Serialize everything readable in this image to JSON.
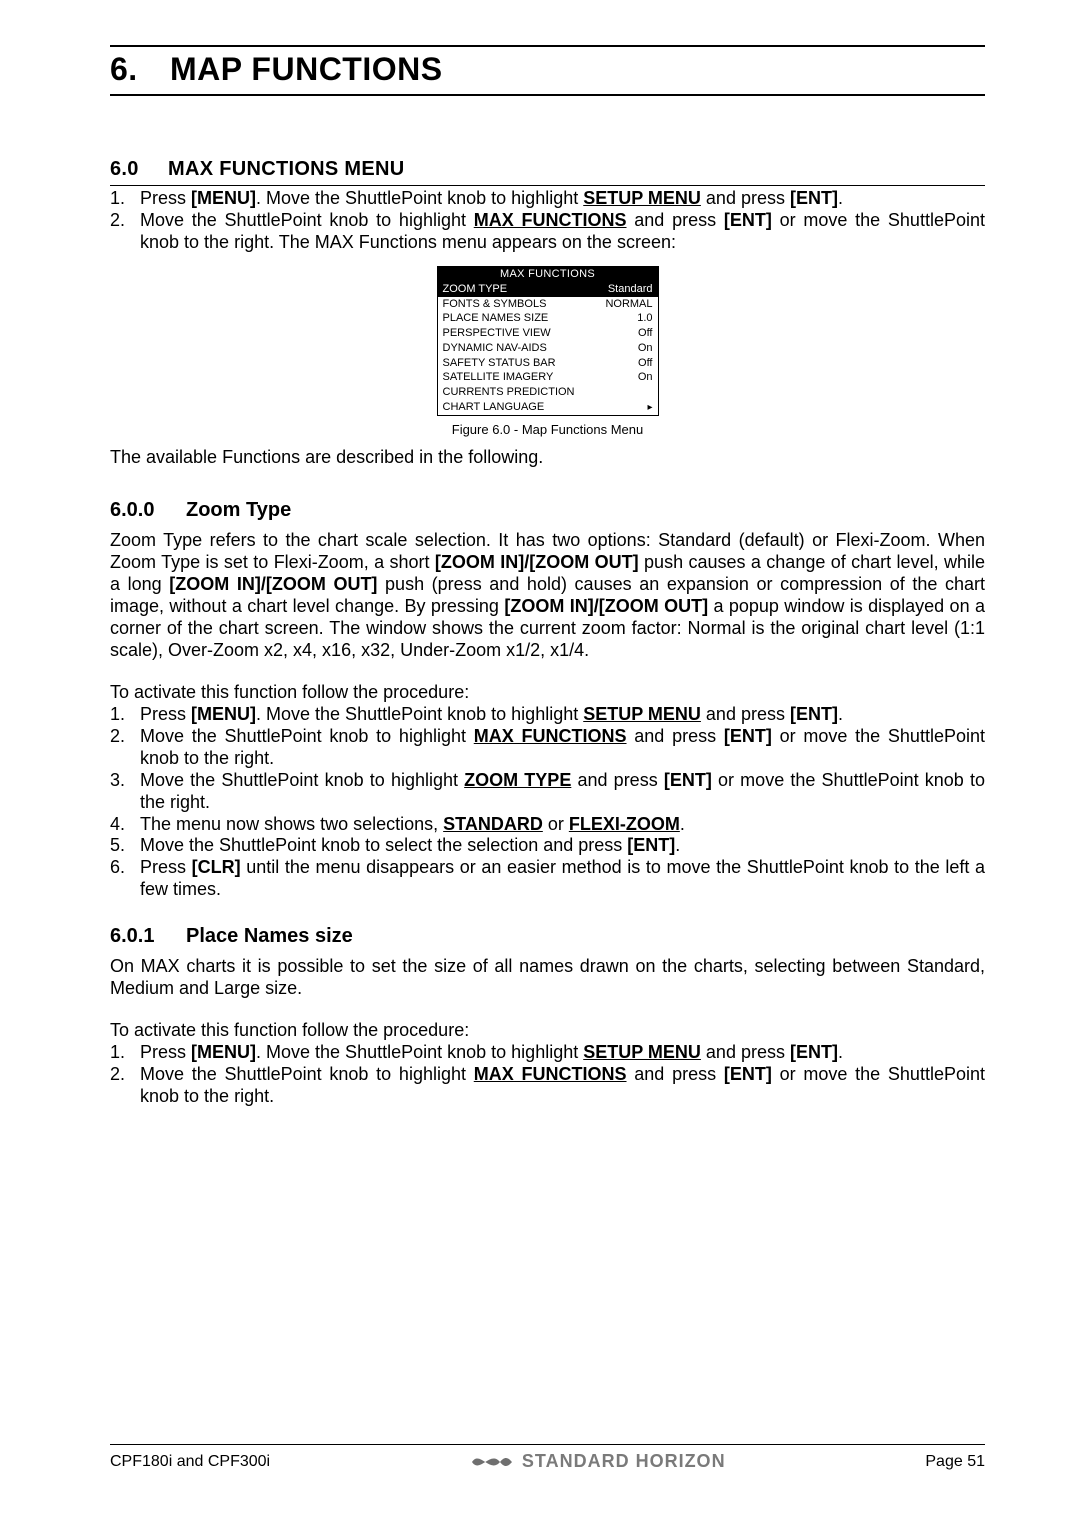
{
  "chapter": {
    "num": "6.",
    "title": "MAP FUNCTIONS"
  },
  "s60": {
    "num": "6.0",
    "title": "MAX FUNCTIONS MENU",
    "steps": [
      {
        "n": "1.",
        "pre": "Press ",
        "k1": "[MENU]",
        "mid": ". Move the ShuttlePoint knob to highlight ",
        "u1": "SETUP MENU",
        "post1": " and press ",
        "k2": "[ENT]",
        "end": "."
      },
      {
        "n": "2.",
        "pre": "Move the ShuttlePoint knob to highlight ",
        "u1": "MAX FUNCTIONS",
        "mid": " and press ",
        "k1": "[ENT]",
        "post1": " or move the ShuttlePoint knob to the right. The MAX Functions menu appears on the screen:"
      }
    ],
    "menu": {
      "title": "MAX FUNCTIONS",
      "rows": [
        {
          "label": "ZOOM TYPE",
          "value": "Standard",
          "sel": true
        },
        {
          "label": "FONTS & SYMBOLS",
          "value": "NORMAL"
        },
        {
          "label": "PLACE NAMES SIZE",
          "value": "1.0"
        },
        {
          "label": "PERSPECTIVE VIEW",
          "value": "Off"
        },
        {
          "label": "DYNAMIC NAV-AIDS",
          "value": "On"
        },
        {
          "label": "SAFETY STATUS BAR",
          "value": "Off"
        },
        {
          "label": "SATELLITE IMAGERY",
          "value": "On"
        },
        {
          "label": "CURRENTS PREDICTION",
          "value": ""
        },
        {
          "label": "CHART LANGUAGE",
          "value": "",
          "arrow": true
        }
      ],
      "caption": "Figure 6.0 - Map Functions Menu"
    },
    "after": "The available Functions are described in the following."
  },
  "s600": {
    "num": "6.0.0",
    "title": "Zoom Type",
    "para1a": "Zoom Type refers to the chart scale selection. It has two options: Standard (default) or Flexi-Zoom. When Zoom Type is set to Flexi-Zoom, a short ",
    "k1": "[ZOOM IN]/[ZOOM OUT]",
    "para1b": " push causes a change of chart level, while a long ",
    "k2": "[ZOOM IN]/[ZOOM OUT]",
    "para1c": " push (press and hold) causes an expansion or compression of the chart image, without a chart level change.",
    "para2a": "By pressing ",
    "k3": "[ZOOM IN]/[ZOOM OUT]",
    "para2b": " a popup window is displayed on a corner of the chart screen. The window shows the current zoom factor: Normal is the original chart level (1:1 scale), Over-Zoom x2, x4, x16, x32, Under-Zoom x1/2, x1/4.",
    "lead": "To activate this function follow the procedure:",
    "steps_n": [
      "1.",
      "2.",
      "3.",
      "4.",
      "5.",
      "6."
    ]
  },
  "s601": {
    "num": "6.0.1",
    "title": "Place Names size",
    "para": "On MAX charts it is possible to set the size of all names drawn on the charts, selecting between Standard, Medium and Large size.",
    "lead": "To activate this function follow the procedure:",
    "steps_n": [
      "1.",
      "2."
    ]
  },
  "labels": {
    "menu": "[MENU]",
    "ent": "[ENT]",
    "clr": "[CLR]",
    "setup": "SETUP MENU",
    "maxf": "MAX FUNCTIONS",
    "zoomt": "ZOOM TYPE",
    "standard": "STANDARD",
    "flexi": "FLEXI-ZOOM"
  },
  "strings": {
    "press": "Press ",
    "dot_move": ". Move the ShuttlePoint knob to highlight ",
    "and_press": " and press ",
    "period": ".",
    "move_hl": "Move the ShuttlePoint knob to highlight ",
    "or_move_right": " or move the ShuttlePoint knob to the right.",
    "or_move_right_sp": "  or move the ShuttlePoint knob to the right.",
    "sp_and_press": "  and press ",
    "menu_two_sel": "The menu now shows two selections, ",
    "or_sp": " or ",
    "move_select": "Move the ShuttlePoint knob to select the selection and press ",
    "clr_tail": " until the menu disappears or an easier method is to move the ShuttlePoint knob to the left a few times."
  },
  "footer": {
    "left": "CPF180i and CPF300i",
    "brand": "STANDARD HORIZON",
    "right": "Page 51"
  }
}
